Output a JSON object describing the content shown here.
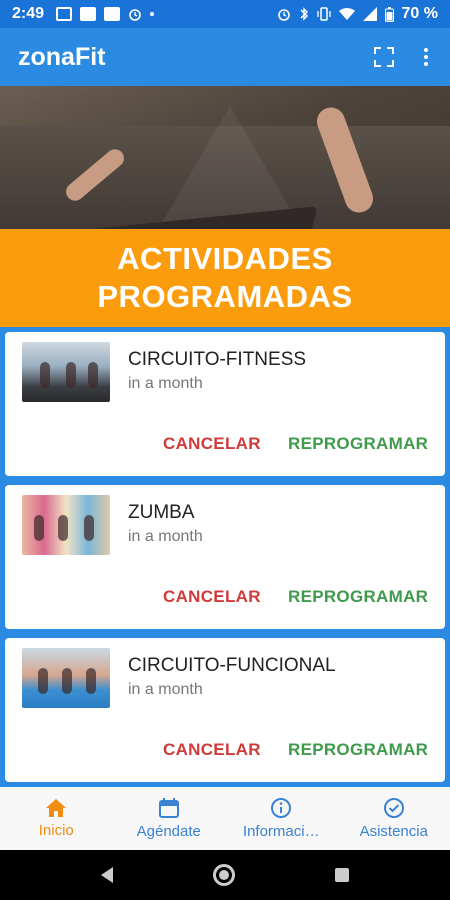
{
  "status_bar": {
    "time": "2:49",
    "battery": "70 %",
    "icons": [
      "message-icon",
      "square-icon",
      "square-icon",
      "alarm-icon",
      "dot-icon",
      "alarm-icon",
      "bluetooth-icon",
      "vibrate-icon",
      "wifi-icon",
      "signal-icon",
      "battery-icon"
    ]
  },
  "app_bar": {
    "title": "zonaFit",
    "icons": [
      "fullscreen-icon",
      "more-vert-icon"
    ]
  },
  "section": {
    "title_line1": "ACTIVIDADES",
    "title_line2": "PROGRAMADAS"
  },
  "activities": [
    {
      "name": "CIRCUITO-FITNESS",
      "when": "in a month",
      "cancel_label": "CANCELAR",
      "reschedule_label": "REPROGRAMAR"
    },
    {
      "name": "ZUMBA",
      "when": "in a month",
      "cancel_label": "CANCELAR",
      "reschedule_label": "REPROGRAMAR"
    },
    {
      "name": "CIRCUITO-FUNCIONAL",
      "when": "in a month",
      "cancel_label": "CANCELAR",
      "reschedule_label": "REPROGRAMAR"
    }
  ],
  "bottom_nav": {
    "items": [
      {
        "label": "Inicio",
        "icon": "home-icon",
        "active": true
      },
      {
        "label": "Agéndate",
        "icon": "calendar-icon",
        "active": false
      },
      {
        "label": "Informaci…",
        "icon": "info-icon",
        "active": false
      },
      {
        "label": "Asistencia",
        "icon": "check-circle-icon",
        "active": false
      }
    ]
  },
  "colors": {
    "primary": "#2b8be3",
    "accent": "#fb9c0c",
    "cancel": "#d03a3a",
    "reschedule": "#3f9a4c",
    "nav_active": "#f08d12",
    "nav_inactive": "#3a82d3"
  }
}
